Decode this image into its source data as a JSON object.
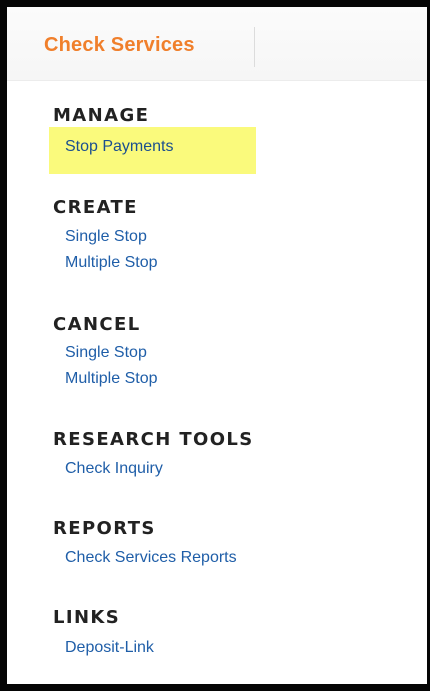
{
  "tab": {
    "label": "Check Services"
  },
  "sections": {
    "manage": {
      "heading": "MANAGE",
      "links": [
        "Stop Payments"
      ]
    },
    "create": {
      "heading": "CREATE",
      "links": [
        "Single Stop",
        "Multiple Stop"
      ]
    },
    "cancel": {
      "heading": "CANCEL",
      "links": [
        "Single Stop",
        "Multiple Stop"
      ]
    },
    "research_tools": {
      "heading": "RESEARCH TOOLS",
      "links": [
        "Check Inquiry"
      ]
    },
    "reports": {
      "heading": "REPORTS",
      "links": [
        "Check Services Reports"
      ]
    },
    "links": {
      "heading": "LINKS",
      "links": [
        "Deposit-Link"
      ]
    }
  },
  "colors": {
    "tab_text": "#f07f2b",
    "link": "#1f5ea8",
    "heading": "#222222",
    "highlight": "#fafa7c"
  }
}
